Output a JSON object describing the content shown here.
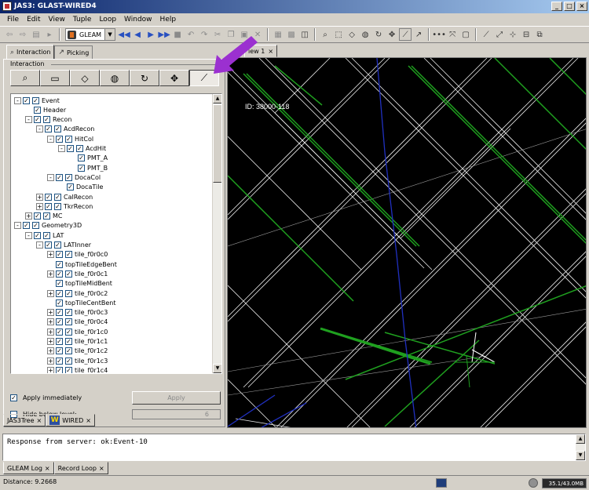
{
  "window": {
    "title": "JAS3: GLAST-WIRED4",
    "buttons": [
      "_",
      "□",
      "×"
    ]
  },
  "menu": [
    "File",
    "Edit",
    "View",
    "Tuple",
    "Loop",
    "Window",
    "Help"
  ],
  "toolbar": {
    "combo_label": "GLEAM"
  },
  "left_tabs": [
    {
      "label": "Interaction",
      "icon": "magnifier"
    },
    {
      "label": "Picking",
      "icon": "cursor"
    }
  ],
  "interaction": {
    "group_label": "Interaction",
    "buttons": [
      "zoom",
      "rectangle-zoom",
      "rotate-plane",
      "sphere",
      "rotate",
      "pan",
      "ruler"
    ]
  },
  "tree": [
    {
      "label": "Event",
      "level": 0,
      "expander": "-",
      "checked": true,
      "double": true
    },
    {
      "label": "Header",
      "level": 1,
      "expander": "",
      "checked": true,
      "double": false
    },
    {
      "label": "Recon",
      "level": 1,
      "expander": "-",
      "checked": true,
      "double": true
    },
    {
      "label": "AcdRecon",
      "level": 2,
      "expander": "-",
      "checked": true,
      "double": true
    },
    {
      "label": "HitCol",
      "level": 3,
      "expander": "-",
      "checked": true,
      "double": true
    },
    {
      "label": "AcdHit",
      "level": 4,
      "expander": "-",
      "checked": true,
      "double": true
    },
    {
      "label": "PMT_A",
      "level": 5,
      "expander": "",
      "checked": true,
      "double": false
    },
    {
      "label": "PMT_B",
      "level": 5,
      "expander": "",
      "checked": true,
      "double": false
    },
    {
      "label": "DocaCol",
      "level": 3,
      "expander": "-",
      "checked": true,
      "double": true
    },
    {
      "label": "DocaTile",
      "level": 4,
      "expander": "",
      "checked": true,
      "double": false
    },
    {
      "label": "CalRecon",
      "level": 2,
      "expander": "+",
      "checked": true,
      "double": true
    },
    {
      "label": "TkrRecon",
      "level": 2,
      "expander": "+",
      "checked": true,
      "double": true
    },
    {
      "label": "MC",
      "level": 1,
      "expander": "+",
      "checked": true,
      "double": true
    },
    {
      "label": "Geometry3D",
      "level": 0,
      "expander": "-",
      "checked": true,
      "double": true
    },
    {
      "label": "LAT",
      "level": 1,
      "expander": "-",
      "checked": true,
      "double": true
    },
    {
      "label": "LATInner",
      "level": 2,
      "expander": "-",
      "checked": true,
      "double": true
    },
    {
      "label": "tile_f0r0c0",
      "level": 3,
      "expander": "+",
      "checked": true,
      "double": true
    },
    {
      "label": "topTileEdgeBent",
      "level": 3,
      "expander": "",
      "checked": true,
      "double": false
    },
    {
      "label": "tile_f0r0c1",
      "level": 3,
      "expander": "+",
      "checked": true,
      "double": true
    },
    {
      "label": "topTileMidBent",
      "level": 3,
      "expander": "",
      "checked": true,
      "double": false
    },
    {
      "label": "tile_f0r0c2",
      "level": 3,
      "expander": "+",
      "checked": true,
      "double": true
    },
    {
      "label": "topTileCentBent",
      "level": 3,
      "expander": "",
      "checked": true,
      "double": false
    },
    {
      "label": "tile_f0r0c3",
      "level": 3,
      "expander": "+",
      "checked": true,
      "double": true
    },
    {
      "label": "tile_f0r0c4",
      "level": 3,
      "expander": "+",
      "checked": true,
      "double": true
    },
    {
      "label": "tile_f0r1c0",
      "level": 3,
      "expander": "+",
      "checked": true,
      "double": true
    },
    {
      "label": "tile_f0r1c1",
      "level": 3,
      "expander": "+",
      "checked": true,
      "double": true
    },
    {
      "label": "tile_f0r1c2",
      "level": 3,
      "expander": "+",
      "checked": true,
      "double": true
    },
    {
      "label": "tile_f0r1c3",
      "level": 3,
      "expander": "+",
      "checked": true,
      "double": true
    },
    {
      "label": "tile_f0r1c4",
      "level": 3,
      "expander": "+",
      "checked": true,
      "double": true
    }
  ],
  "options": {
    "apply_immediately": "Apply immediately",
    "apply_button": "Apply",
    "hide_below": "Hide below level:",
    "hide_level": "6"
  },
  "bottom_left_tabs": [
    "JAS3Tree",
    "WIRED"
  ],
  "view": {
    "tab_label": "iew 1",
    "id_label": "ID: 38000-118"
  },
  "console": {
    "text": "Response from server: ok:Event-10"
  },
  "bottom_tabs": [
    "GLEAM Log",
    "Record Loop"
  ],
  "status": {
    "distance": "Distance: 9.2668",
    "memory": "35.1/43.0MB"
  },
  "colors": {
    "accent": "#9b30d0",
    "track_green": "#1fa01f",
    "track_blue": "#2030c0"
  }
}
